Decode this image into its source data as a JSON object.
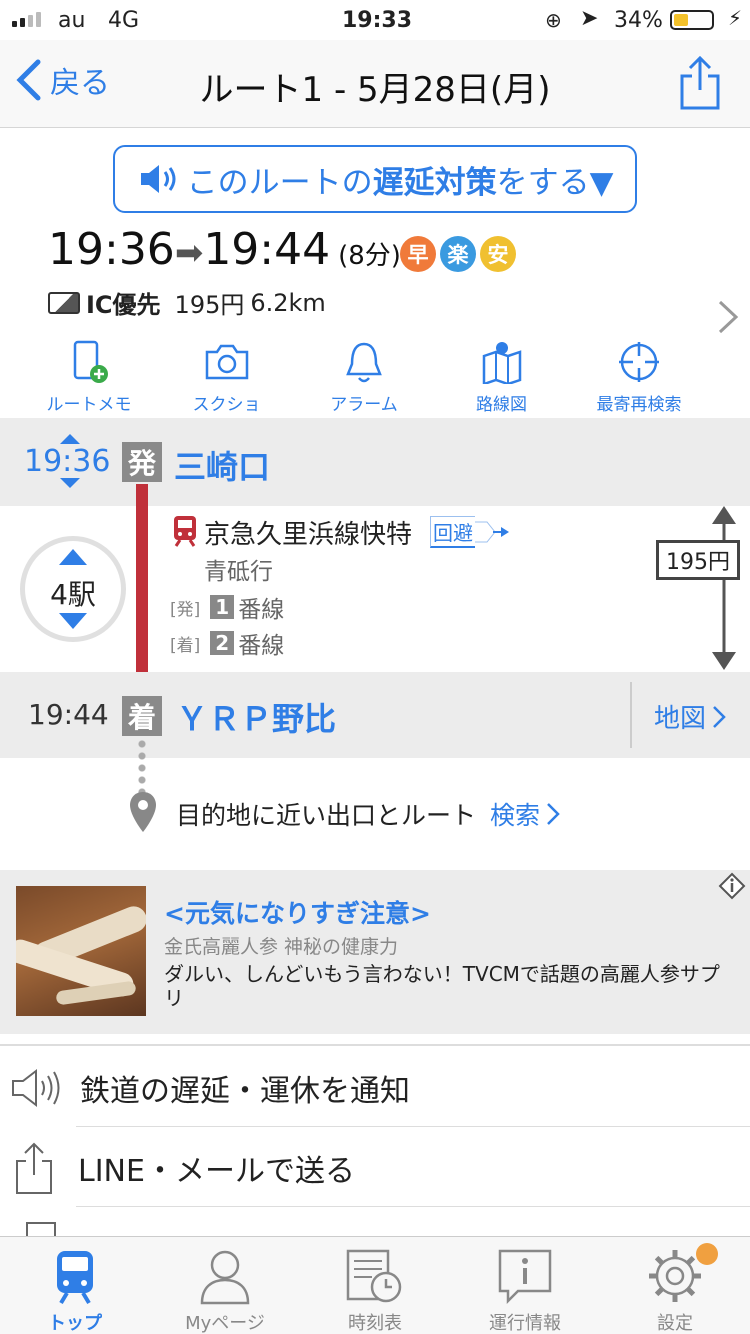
{
  "status_bar": {
    "carrier": "au",
    "network": "4G",
    "time": "19:33",
    "battery": "34%"
  },
  "nav": {
    "back_label": "戻る",
    "title": "ルート1 - 5月28日(月)"
  },
  "delay_button": {
    "pre": "このルートの",
    "emphasis": "遅延対策",
    "post": "をする▼"
  },
  "summary": {
    "depart": "19:36",
    "arrow": "➡",
    "arrive": "19:44",
    "duration": "(8分)",
    "badges": [
      {
        "label": "早",
        "color": "#f07a3a"
      },
      {
        "label": "楽",
        "color": "#3a9ae0"
      },
      {
        "label": "安",
        "color": "#f0c030"
      }
    ],
    "ic_label": "IC優先",
    "fare": "195円",
    "distance": "6.2km"
  },
  "tools": [
    {
      "label": "ルートメモ",
      "icon": "phone-add-icon"
    },
    {
      "label": "スクショ",
      "icon": "camera-icon"
    },
    {
      "label": "アラーム",
      "icon": "bell-icon"
    },
    {
      "label": "路線図",
      "icon": "map-icon"
    },
    {
      "label": "最寄再検索",
      "icon": "crosshair-icon"
    }
  ],
  "departure": {
    "time": "19:36",
    "mark": "発",
    "station": "三崎口"
  },
  "segment": {
    "stops": "4駅",
    "line": "京急久里浜線快特",
    "detour": "回避",
    "destination": "青砥行",
    "dep_tag": "[発]",
    "dep_platform_num": "1",
    "dep_platform": "番線",
    "arr_tag": "[着]",
    "arr_platform_num": "2",
    "arr_platform": "番線",
    "fare": "195円",
    "line_color": "#c0303a"
  },
  "arrival": {
    "time": "19:44",
    "mark": "着",
    "station": "ＹＲＰ野比",
    "map_link": "地図"
  },
  "exit": {
    "text": "目的地に近い出口とルート",
    "link": "検索"
  },
  "ad": {
    "title": "<元気になりすぎ注意>",
    "sponsor": "金氏高麗人参 神秘の健康力",
    "body": "ダルい、しんどいもう言わない！TVCMで話題の高麗人参サプリ"
  },
  "actions": [
    {
      "label": "鉄道の遅延・運休を通知",
      "icon": "speaker-icon"
    },
    {
      "label": "LINE・メールで送る",
      "icon": "share-icon"
    }
  ],
  "tabbar": [
    {
      "label": "トップ",
      "icon": "train-icon",
      "active": true
    },
    {
      "label": "Myページ",
      "icon": "person-icon",
      "active": false
    },
    {
      "label": "時刻表",
      "icon": "timetable-icon",
      "active": false
    },
    {
      "label": "運行情報",
      "icon": "info-icon",
      "active": false
    },
    {
      "label": "設定",
      "icon": "gear-icon",
      "active": false
    }
  ]
}
